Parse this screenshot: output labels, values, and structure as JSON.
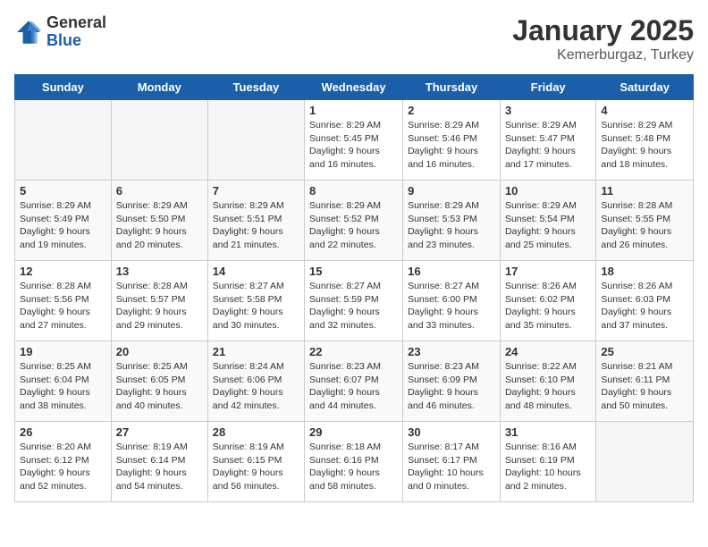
{
  "logo": {
    "general": "General",
    "blue": "Blue"
  },
  "title": "January 2025",
  "location": "Kemerburgaz, Turkey",
  "weekdays": [
    "Sunday",
    "Monday",
    "Tuesday",
    "Wednesday",
    "Thursday",
    "Friday",
    "Saturday"
  ],
  "weeks": [
    [
      {
        "day": "",
        "info": ""
      },
      {
        "day": "",
        "info": ""
      },
      {
        "day": "",
        "info": ""
      },
      {
        "day": "1",
        "info": "Sunrise: 8:29 AM\nSunset: 5:45 PM\nDaylight: 9 hours and 16 minutes."
      },
      {
        "day": "2",
        "info": "Sunrise: 8:29 AM\nSunset: 5:46 PM\nDaylight: 9 hours and 16 minutes."
      },
      {
        "day": "3",
        "info": "Sunrise: 8:29 AM\nSunset: 5:47 PM\nDaylight: 9 hours and 17 minutes."
      },
      {
        "day": "4",
        "info": "Sunrise: 8:29 AM\nSunset: 5:48 PM\nDaylight: 9 hours and 18 minutes."
      }
    ],
    [
      {
        "day": "5",
        "info": "Sunrise: 8:29 AM\nSunset: 5:49 PM\nDaylight: 9 hours and 19 minutes."
      },
      {
        "day": "6",
        "info": "Sunrise: 8:29 AM\nSunset: 5:50 PM\nDaylight: 9 hours and 20 minutes."
      },
      {
        "day": "7",
        "info": "Sunrise: 8:29 AM\nSunset: 5:51 PM\nDaylight: 9 hours and 21 minutes."
      },
      {
        "day": "8",
        "info": "Sunrise: 8:29 AM\nSunset: 5:52 PM\nDaylight: 9 hours and 22 minutes."
      },
      {
        "day": "9",
        "info": "Sunrise: 8:29 AM\nSunset: 5:53 PM\nDaylight: 9 hours and 23 minutes."
      },
      {
        "day": "10",
        "info": "Sunrise: 8:29 AM\nSunset: 5:54 PM\nDaylight: 9 hours and 25 minutes."
      },
      {
        "day": "11",
        "info": "Sunrise: 8:28 AM\nSunset: 5:55 PM\nDaylight: 9 hours and 26 minutes."
      }
    ],
    [
      {
        "day": "12",
        "info": "Sunrise: 8:28 AM\nSunset: 5:56 PM\nDaylight: 9 hours and 27 minutes."
      },
      {
        "day": "13",
        "info": "Sunrise: 8:28 AM\nSunset: 5:57 PM\nDaylight: 9 hours and 29 minutes."
      },
      {
        "day": "14",
        "info": "Sunrise: 8:27 AM\nSunset: 5:58 PM\nDaylight: 9 hours and 30 minutes."
      },
      {
        "day": "15",
        "info": "Sunrise: 8:27 AM\nSunset: 5:59 PM\nDaylight: 9 hours and 32 minutes."
      },
      {
        "day": "16",
        "info": "Sunrise: 8:27 AM\nSunset: 6:00 PM\nDaylight: 9 hours and 33 minutes."
      },
      {
        "day": "17",
        "info": "Sunrise: 8:26 AM\nSunset: 6:02 PM\nDaylight: 9 hours and 35 minutes."
      },
      {
        "day": "18",
        "info": "Sunrise: 8:26 AM\nSunset: 6:03 PM\nDaylight: 9 hours and 37 minutes."
      }
    ],
    [
      {
        "day": "19",
        "info": "Sunrise: 8:25 AM\nSunset: 6:04 PM\nDaylight: 9 hours and 38 minutes."
      },
      {
        "day": "20",
        "info": "Sunrise: 8:25 AM\nSunset: 6:05 PM\nDaylight: 9 hours and 40 minutes."
      },
      {
        "day": "21",
        "info": "Sunrise: 8:24 AM\nSunset: 6:06 PM\nDaylight: 9 hours and 42 minutes."
      },
      {
        "day": "22",
        "info": "Sunrise: 8:23 AM\nSunset: 6:07 PM\nDaylight: 9 hours and 44 minutes."
      },
      {
        "day": "23",
        "info": "Sunrise: 8:23 AM\nSunset: 6:09 PM\nDaylight: 9 hours and 46 minutes."
      },
      {
        "day": "24",
        "info": "Sunrise: 8:22 AM\nSunset: 6:10 PM\nDaylight: 9 hours and 48 minutes."
      },
      {
        "day": "25",
        "info": "Sunrise: 8:21 AM\nSunset: 6:11 PM\nDaylight: 9 hours and 50 minutes."
      }
    ],
    [
      {
        "day": "26",
        "info": "Sunrise: 8:20 AM\nSunset: 6:12 PM\nDaylight: 9 hours and 52 minutes."
      },
      {
        "day": "27",
        "info": "Sunrise: 8:19 AM\nSunset: 6:14 PM\nDaylight: 9 hours and 54 minutes."
      },
      {
        "day": "28",
        "info": "Sunrise: 8:19 AM\nSunset: 6:15 PM\nDaylight: 9 hours and 56 minutes."
      },
      {
        "day": "29",
        "info": "Sunrise: 8:18 AM\nSunset: 6:16 PM\nDaylight: 9 hours and 58 minutes."
      },
      {
        "day": "30",
        "info": "Sunrise: 8:17 AM\nSunset: 6:17 PM\nDaylight: 10 hours and 0 minutes."
      },
      {
        "day": "31",
        "info": "Sunrise: 8:16 AM\nSunset: 6:19 PM\nDaylight: 10 hours and 2 minutes."
      },
      {
        "day": "",
        "info": ""
      }
    ]
  ]
}
